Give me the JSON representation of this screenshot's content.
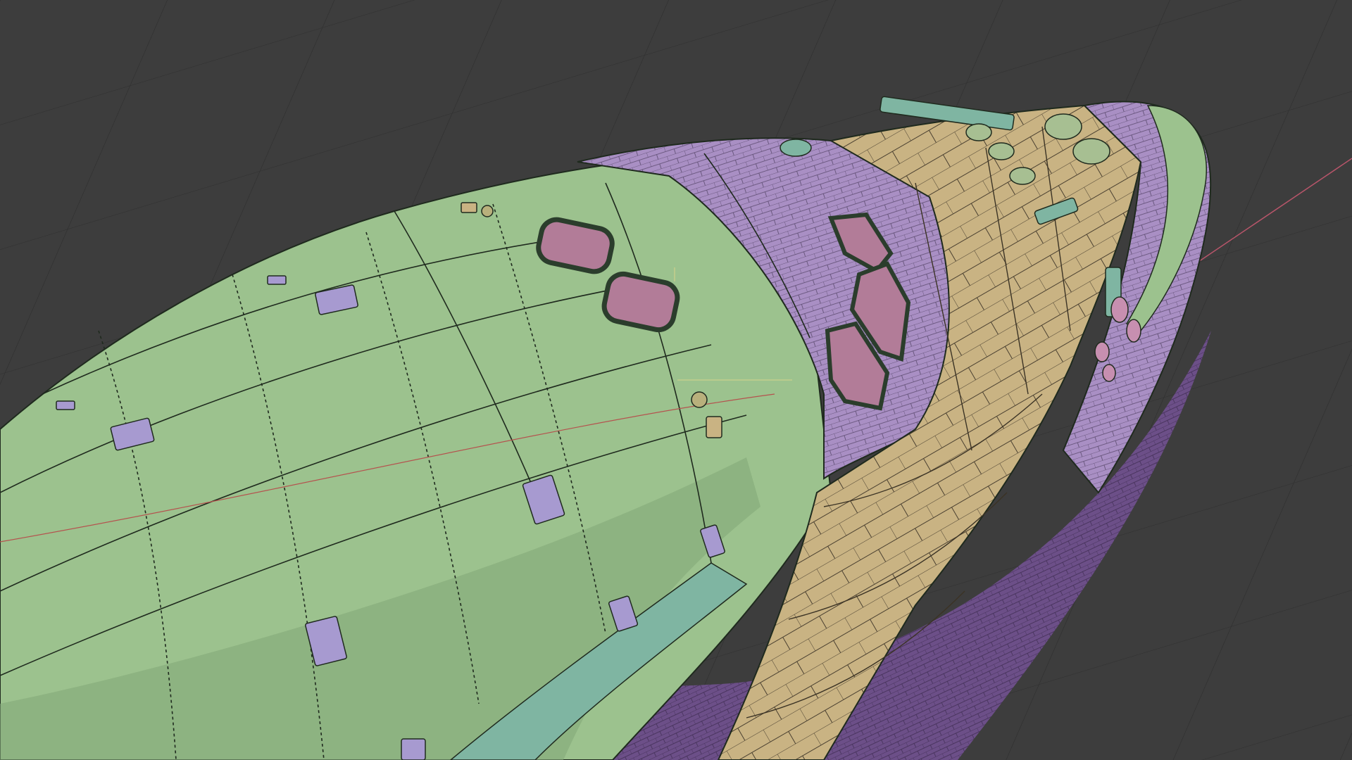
{
  "viewport": {
    "background": "#3d3d3d",
    "grid_color": "#2e2e2e",
    "x_axis_color": "#b8556a",
    "shading_mode": "solid-viewport-color"
  },
  "model": {
    "subject": "space-shuttle-orbiter-nose",
    "colors": {
      "fuselage_green": "#9cc28e",
      "fuselage_green_dark": "#84a878",
      "tile_purple": "#a98fc4",
      "tile_purple_dark": "#6c4f88",
      "blanket_tan": "#c9b383",
      "rcs_teal": "#7fb5a2",
      "window_pink": "#b27c98",
      "panel_line": "#1f2a1e",
      "label_plate": "#a79ad0"
    }
  }
}
